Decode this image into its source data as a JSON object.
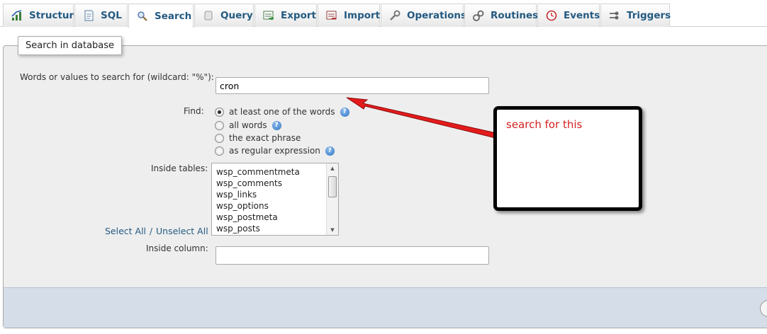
{
  "tabs": [
    {
      "label": "Structure",
      "icon": "structure-icon"
    },
    {
      "label": "SQL",
      "icon": "sql-icon"
    },
    {
      "label": "Search",
      "icon": "search-icon",
      "active": true
    },
    {
      "label": "Query",
      "icon": "query-icon"
    },
    {
      "label": "Export",
      "icon": "export-icon"
    },
    {
      "label": "Import",
      "icon": "import-icon"
    },
    {
      "label": "Operations",
      "icon": "wrench-icon"
    },
    {
      "label": "Routines",
      "icon": "routines-icon"
    },
    {
      "label": "Events",
      "icon": "clock-icon"
    },
    {
      "label": "Triggers",
      "icon": "triggers-icon"
    }
  ],
  "form": {
    "legend": "Search in database",
    "words_label": "Words or values to search for (wildcard: \"%\"):",
    "words_value": "cron",
    "find_label": "Find:",
    "find_options": [
      {
        "label": "at least one of the words",
        "checked": true,
        "help": true
      },
      {
        "label": "all words",
        "checked": false,
        "help": true
      },
      {
        "label": "the exact phrase",
        "checked": false,
        "help": false
      },
      {
        "label": "as regular expression",
        "checked": false,
        "help": true
      }
    ],
    "tables_label": "Inside tables:",
    "tables": [
      "wsp_commentmeta",
      "wsp_comments",
      "wsp_links",
      "wsp_options",
      "wsp_postmeta",
      "wsp_posts"
    ],
    "select_all": "Select All",
    "separator": "/",
    "unselect_all": "Unselect All",
    "column_label": "Inside column:",
    "column_value": ""
  },
  "annotation": {
    "text": "search for this",
    "text_color": "#d42020",
    "arrow_color": "#e41b1b"
  },
  "colors": {
    "link": "#235a81",
    "panel": "#eeeeee",
    "footer": "#d5dde9"
  }
}
